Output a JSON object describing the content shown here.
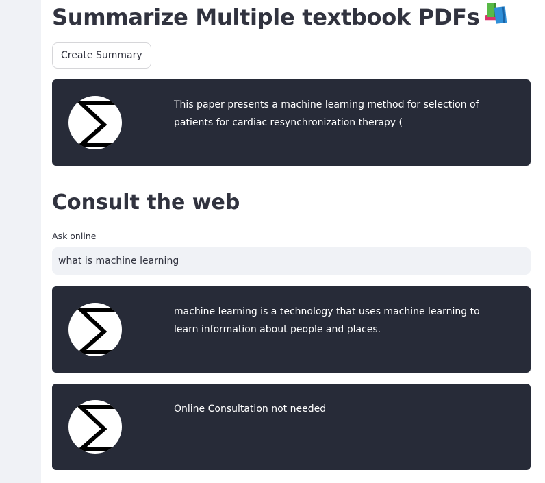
{
  "page": {
    "title": "Summarize Multiple textbook PDFs"
  },
  "icons": {
    "title_icon": "books-icon",
    "avatar_icon": "sigma-icon"
  },
  "summary": {
    "button_label": "Create Summary",
    "response_text": "This paper presents a machine learning method for selection of patients for cardiac resynchronization therapy ("
  },
  "web": {
    "heading": "Consult the web",
    "input_label": "Ask online",
    "input_value": "what is machine learning",
    "responses": [
      "machine learning is a technology that uses machine learning to learn information about people and places.",
      "Online Consultation not needed"
    ]
  },
  "colors": {
    "sidebar_bg": "#f0f2f6",
    "card_bg": "#272b38",
    "text": "#31333f",
    "card_text": "#ffffff"
  }
}
